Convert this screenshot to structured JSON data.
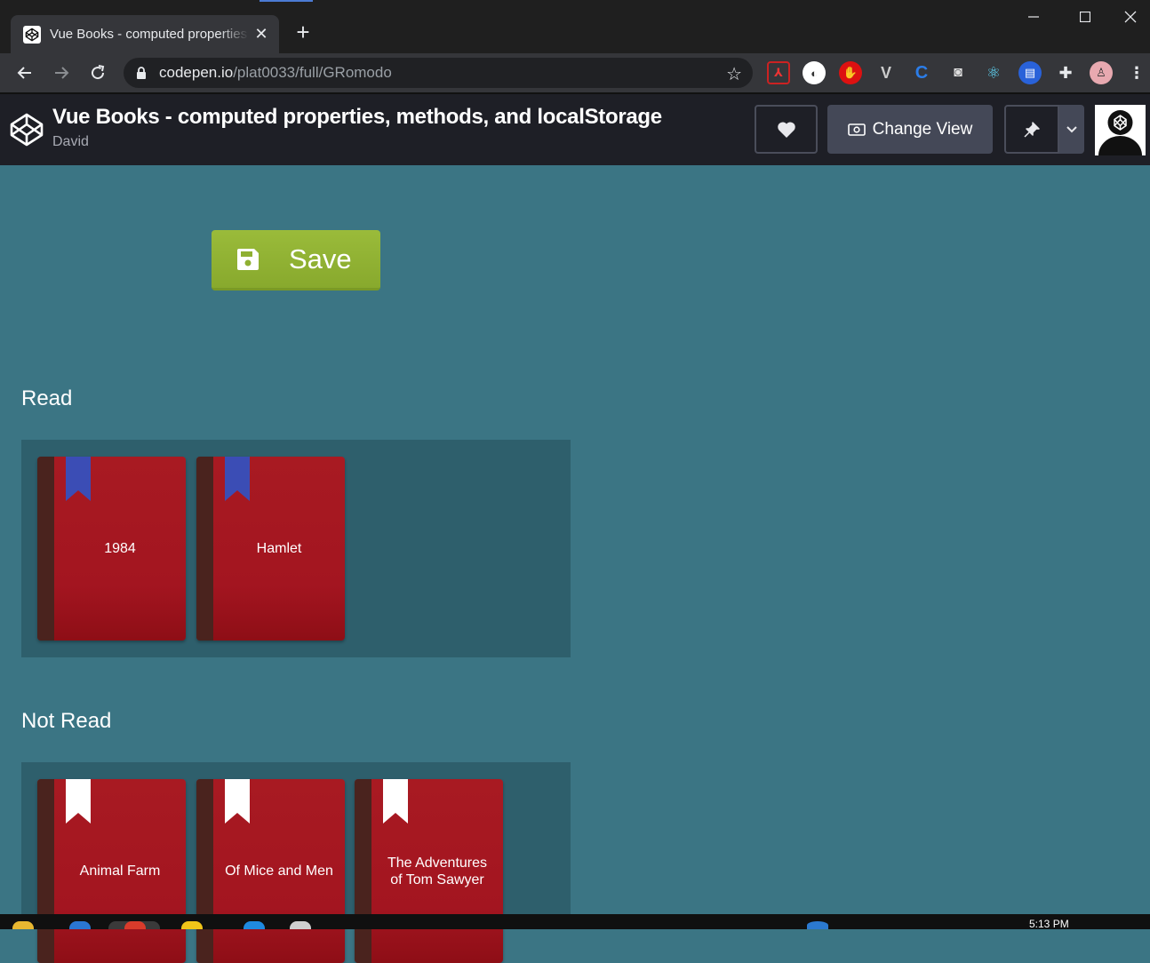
{
  "browser": {
    "tab_title": "Vue Books - computed properties, methods, and localStorage",
    "tab_close": "✕",
    "new_tab": "+",
    "url_host": "codepen.io",
    "url_path": "/plat0033/full/GRomodo"
  },
  "codepen": {
    "title": "Vue Books - computed properties, methods, and localStorage",
    "author": "David",
    "change_view_label": "Change View"
  },
  "app": {
    "save_label": "Save",
    "read_heading": "Read",
    "not_read_heading": "Not Read",
    "read_books": [
      {
        "title": "1984"
      },
      {
        "title": "Hamlet"
      }
    ],
    "not_read_books": [
      {
        "title": "Animal Farm"
      },
      {
        "title": "Of Mice and Men"
      },
      {
        "title": "The Adventures of Tom Sawyer"
      }
    ]
  },
  "taskbar": {
    "clock": "5:13 PM"
  },
  "colors": {
    "page_bg": "#3b7584",
    "shelf_bg": "#2e5f6c",
    "save_green": "#8fb032",
    "book_red": "#a81a22",
    "read_ribbon": "#3b4db5",
    "unread_ribbon": "#ffffff"
  }
}
